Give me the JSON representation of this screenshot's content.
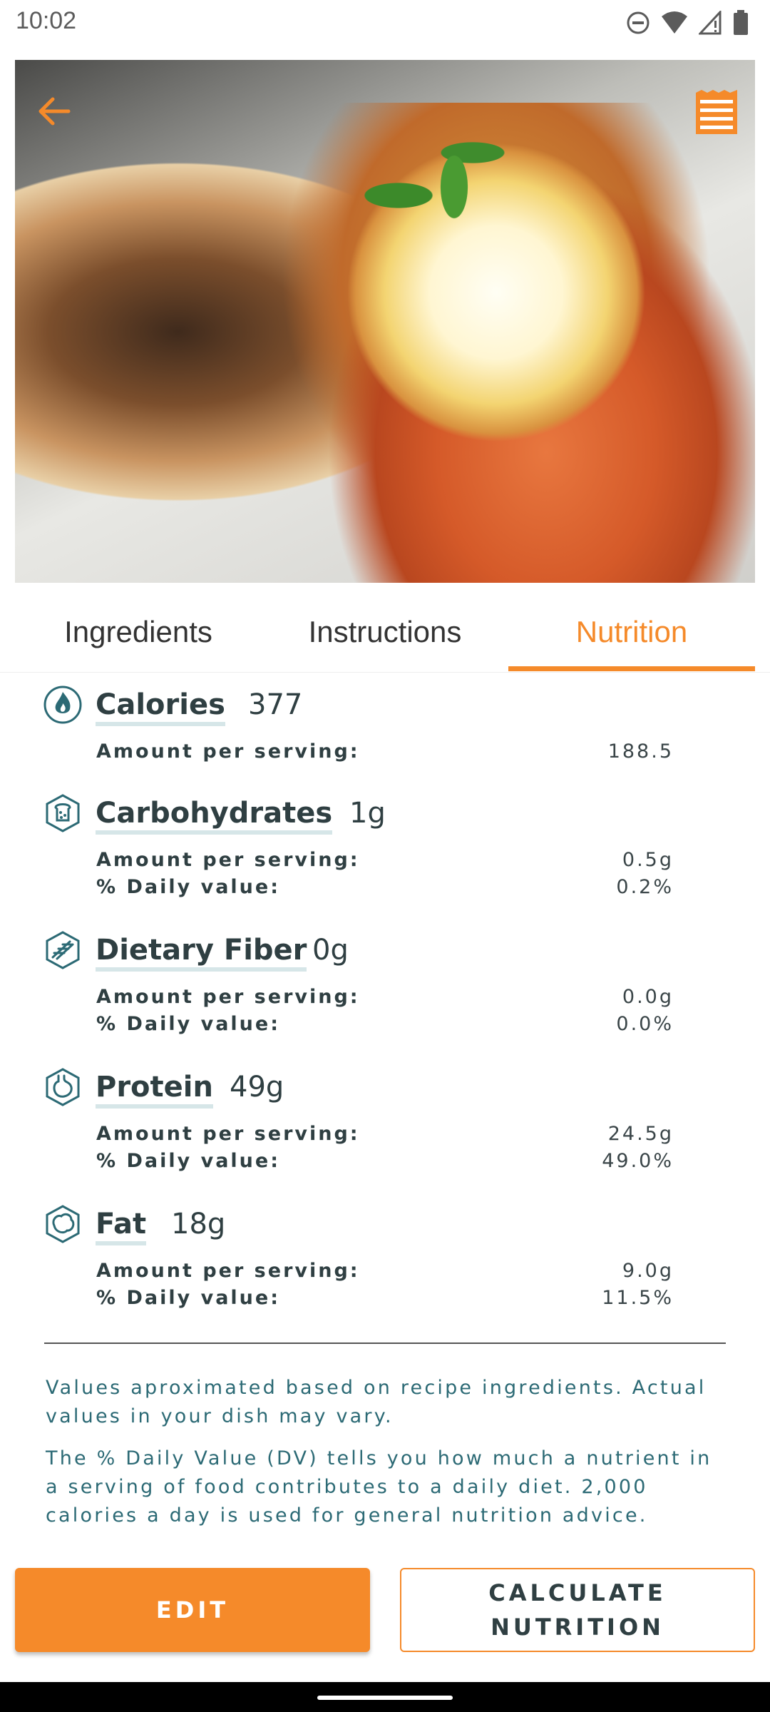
{
  "status": {
    "time": "10:02"
  },
  "tabs": [
    {
      "label": "Ingredients",
      "active": false
    },
    {
      "label": "Instructions",
      "active": false
    },
    {
      "label": "Nutrition",
      "active": true
    }
  ],
  "nutrients": [
    {
      "icon": "flame-icon",
      "name": "Calories",
      "total": "377",
      "rows": [
        {
          "label": "Amount per serving:",
          "value": "188.5"
        }
      ]
    },
    {
      "icon": "bread-icon",
      "name": "Carbohydrates",
      "total": "1g",
      "rows": [
        {
          "label": "Amount per serving:",
          "value": "0.5g"
        },
        {
          "label": "% Daily value:",
          "value": "0.2%"
        }
      ]
    },
    {
      "icon": "fiber-icon",
      "name": "Dietary Fiber",
      "total": "0g",
      "rows": [
        {
          "label": "Amount per serving:",
          "value": "0.0g"
        },
        {
          "label": "% Daily value:",
          "value": "0.0%"
        }
      ]
    },
    {
      "icon": "stomach-icon",
      "name": "Protein",
      "total": "49g",
      "rows": [
        {
          "label": "Amount per serving:",
          "value": "24.5g"
        },
        {
          "label": "% Daily value:",
          "value": "49.0%"
        }
      ]
    },
    {
      "icon": "fat-icon",
      "name": "Fat",
      "total": "18g",
      "rows": [
        {
          "label": "Amount per serving:",
          "value": "9.0g"
        },
        {
          "label": "% Daily value:",
          "value": "11.5%"
        }
      ]
    }
  ],
  "notes": [
    "Values aproximated based on recipe ingredients. Actual values in your dish may vary.",
    "The % Daily Value (DV) tells you how much a nutrient in a serving of food contributes to a daily diet. 2,000 calories a day is used for general nutrition advice."
  ],
  "buttons": {
    "edit": "EDIT",
    "calculate": "CALCULATE NUTRITION"
  },
  "colors": {
    "accent": "#f58a2a",
    "teal": "#2c6a75",
    "text": "#2f3f42"
  }
}
